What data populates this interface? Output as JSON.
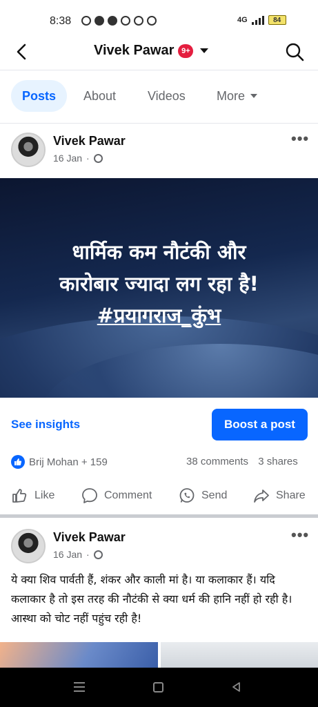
{
  "status_bar": {
    "time": "8:38",
    "network": "4G",
    "battery": "84"
  },
  "header": {
    "title": "Vivek Pawar",
    "badge": "9+"
  },
  "tabs": [
    {
      "label": "Posts",
      "active": true
    },
    {
      "label": "About"
    },
    {
      "label": "Videos"
    },
    {
      "label": "More"
    }
  ],
  "post1": {
    "author": "Vivek Pawar",
    "date": "16 Jan",
    "banner_line1": "धार्मिक कम नौटंकी और",
    "banner_line2": "कारोबार ज्यादा लग रहा है!",
    "banner_hashtag": "#प्रयागराज_कुंभ",
    "see_insights": "See insights",
    "boost": "Boost a post",
    "reactions_text": "Brij Mohan + 159",
    "comments": "38 comments",
    "shares": "3 shares",
    "actions": {
      "like": "Like",
      "comment": "Comment",
      "send": "Send",
      "share": "Share"
    }
  },
  "post2": {
    "author": "Vivek Pawar",
    "date": "16 Jan",
    "text": "ये क्या शिव पार्वती हैं, शंकर और काली मां है। या कलाकार हैं। यदि कलाकार है तो इस तरह की नौटंकी से क्या धर्म की हानि नहीं हो रही है। आस्था को चोट नहीं पहुंच रही है!"
  },
  "colors": {
    "accent": "#0866ff",
    "badge": "#e41e3f",
    "muted": "#65676b"
  }
}
